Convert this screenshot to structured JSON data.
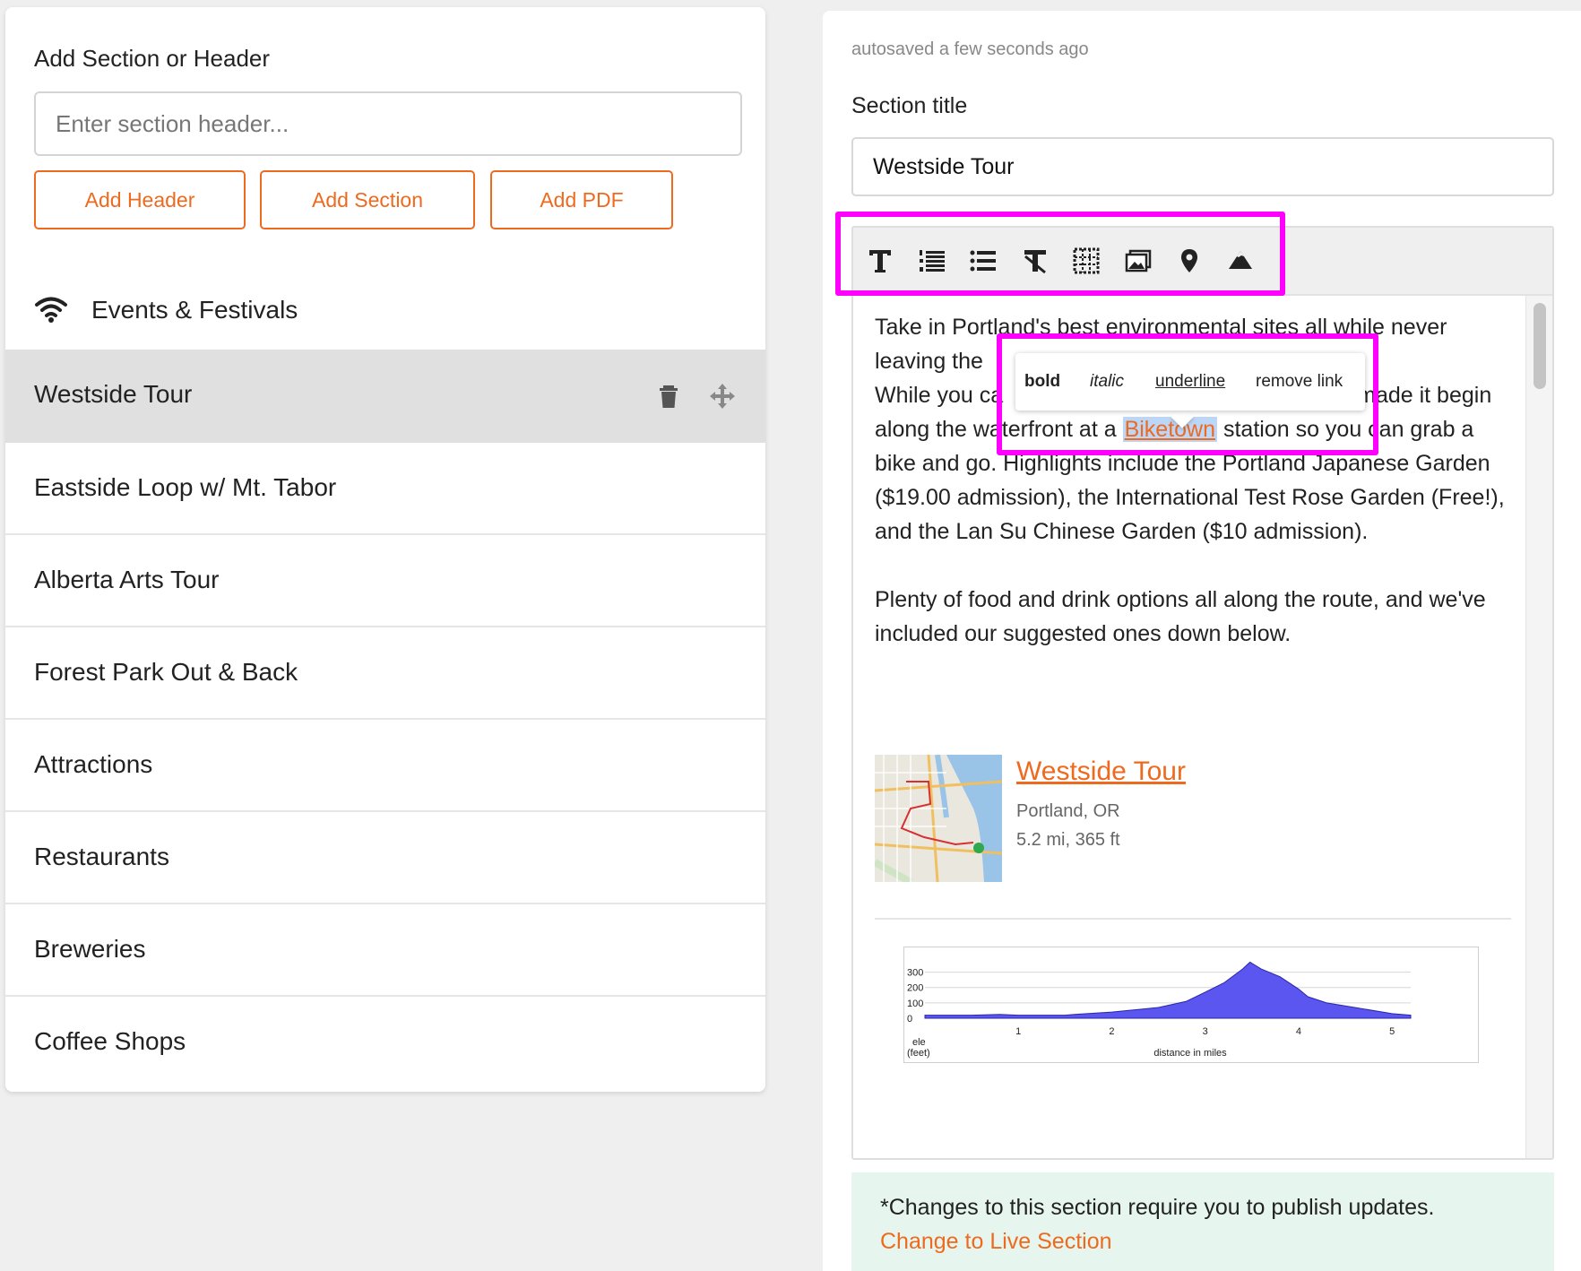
{
  "left": {
    "add_title": "Add Section or Header",
    "header_input_placeholder": "Enter section header...",
    "buttons": {
      "add_header": "Add Header",
      "add_section": "Add Section",
      "add_pdf": "Add PDF"
    },
    "events_header": "Events & Festivals",
    "sections": [
      {
        "label": "Westside Tour",
        "selected": true
      },
      {
        "label": "Eastside Loop w/ Mt. Tabor"
      },
      {
        "label": "Alberta Arts Tour"
      },
      {
        "label": "Forest Park Out & Back"
      },
      {
        "label": "Attractions"
      },
      {
        "label": "Restaurants"
      },
      {
        "label": "Breweries"
      },
      {
        "label": "Coffee Shops"
      }
    ]
  },
  "right": {
    "autosaved": "autosaved a few seconds ago",
    "section_title_label": "Section title",
    "section_title_value": "Westside Tour",
    "toolbar_icons": [
      "text-icon",
      "ordered-list-icon",
      "bullet-list-icon",
      "clear-format-icon",
      "table-icon",
      "image-icon",
      "map-pin-icon",
      "mountain-icon"
    ],
    "editor": {
      "line1": "Take in Portland's best environmental sites all while never",
      "line2": "leaving the ",
      "line3": "While you ca",
      "line3_end": "made it begin",
      "line4_start": "along the wa",
      "line4_mid": "terfront at a ",
      "link_text": "Biketown",
      "line4_end": " station so you can grab a",
      "rest": "bike and go. Highlights include the Portland Japanese Garden ($19.00 admission), the International Test Rose Garden (Free!), and the Lan Su Chinese Garden ($10 admission).",
      "para2": "Plenty of food and drink options all along the route, and we've included our suggested ones down below."
    },
    "popover": {
      "bold": "bold",
      "italic": "italic",
      "underline": "underline",
      "remove_link": "remove link"
    },
    "route": {
      "name": "Westside Tour",
      "location": "Portland, OR",
      "stats": "5.2 mi, 365 ft"
    },
    "elevation_chart": {
      "y_ticks": [
        "300",
        "200",
        "100",
        "0"
      ],
      "x_ticks": [
        "1",
        "2",
        "3",
        "4",
        "5"
      ],
      "ylabel_1": "ele",
      "ylabel_2": "(feet)",
      "xlabel": "distance in miles"
    },
    "publish_note": "*Changes to this section require you to publish updates.",
    "publish_link": "Change to Live Section"
  },
  "colors": {
    "accent": "#ed6a1f",
    "highlight": "#ff00ff",
    "selected_row": "#e0e0e0",
    "elevation_fill": "#5b56f0"
  },
  "chart_data": {
    "type": "area",
    "xlabel": "distance in miles",
    "ylabel": "ele (feet)",
    "xlim": [
      0,
      5.2
    ],
    "ylim": [
      0,
      350
    ],
    "x": [
      0,
      0.5,
      0.8,
      1.0,
      1.5,
      1.6,
      2.0,
      2.5,
      2.8,
      3.0,
      3.2,
      3.4,
      3.48,
      3.6,
      3.8,
      4.0,
      4.1,
      4.3,
      4.6,
      5.0,
      5.2
    ],
    "values": [
      20,
      20,
      25,
      20,
      20,
      25,
      40,
      70,
      110,
      170,
      230,
      320,
      365,
      320,
      270,
      190,
      140,
      100,
      70,
      30,
      20
    ]
  }
}
